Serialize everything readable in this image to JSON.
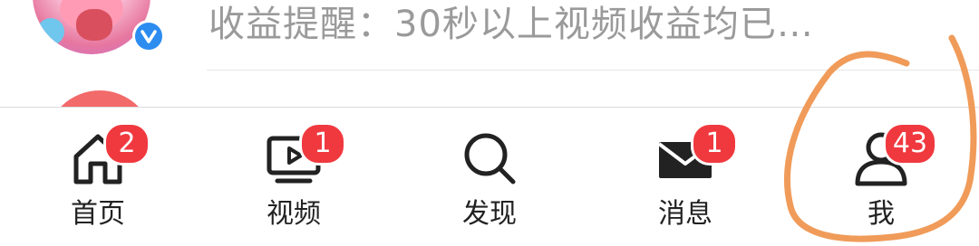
{
  "feed": {
    "preview_text": "收益提醒：30秒以上视频收益均已…"
  },
  "tabs": [
    {
      "id": "home",
      "label": "首页",
      "icon": "home-icon",
      "badge": "2"
    },
    {
      "id": "video",
      "label": "视频",
      "icon": "tv-play-icon",
      "badge": "1"
    },
    {
      "id": "discover",
      "label": "发现",
      "icon": "search-icon",
      "badge": ""
    },
    {
      "id": "messages",
      "label": "消息",
      "icon": "mail-icon",
      "badge": "1"
    },
    {
      "id": "me",
      "label": "我",
      "icon": "person-icon",
      "badge": "43"
    }
  ],
  "colors": {
    "badge": "#f0393f",
    "annotation": "#f09b59",
    "verified": "#2d8cf0"
  }
}
